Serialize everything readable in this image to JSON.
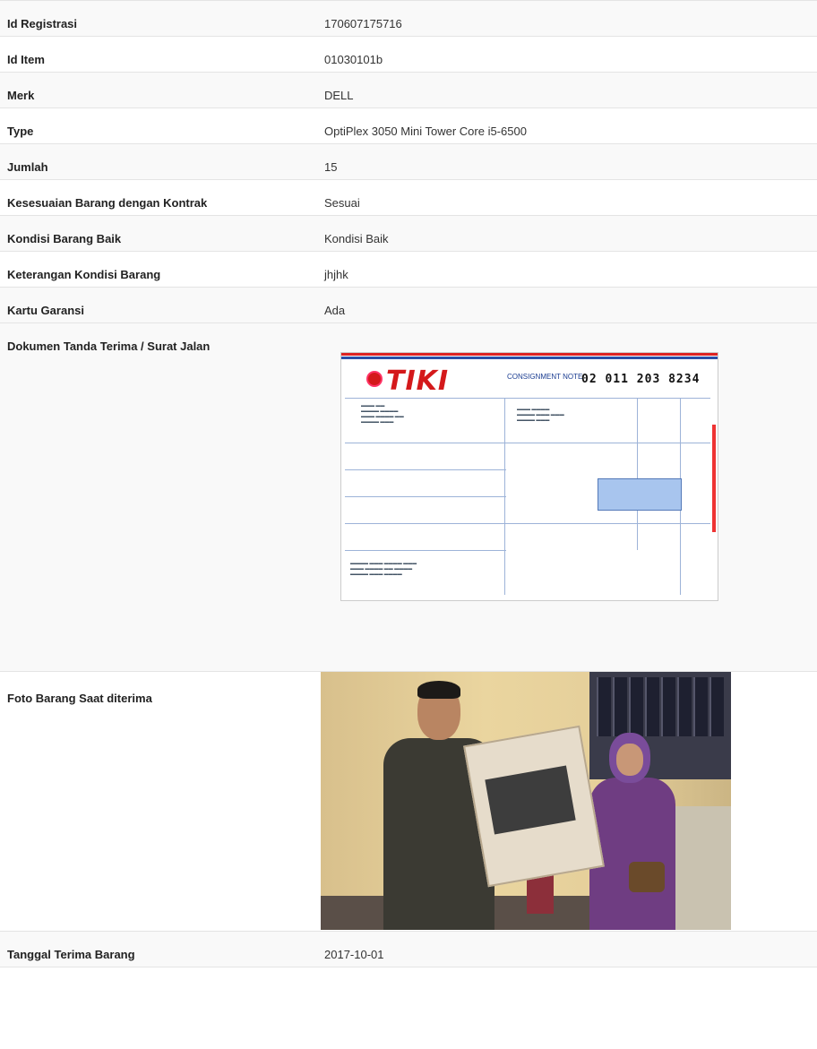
{
  "rows": [
    {
      "label": "Id Registrasi",
      "value": "170607175716"
    },
    {
      "label": "Id Item",
      "value": "01030101b"
    },
    {
      "label": "Merk",
      "value": "DELL"
    },
    {
      "label": "Type",
      "value": "OptiPlex 3050 Mini Tower Core i5-6500"
    },
    {
      "label": "Jumlah",
      "value": "15"
    },
    {
      "label": "Kesesuaian Barang dengan Kontrak",
      "value": "Sesuai"
    },
    {
      "label": "Kondisi Barang Baik",
      "value": "Kondisi Baik"
    },
    {
      "label": "Keterangan Kondisi Barang",
      "value": "jhjhk"
    },
    {
      "label": "Kartu Garansi",
      "value": "Ada"
    }
  ],
  "document_row": {
    "label": "Dokumen Tanda Terima / Surat Jalan",
    "image": {
      "logo_text": "TIKI",
      "consignment_label": "CONSIGNMENT NOTE",
      "consignment_number": "02 011 203 8234"
    }
  },
  "photo_row": {
    "label": "Foto Barang Saat diterima"
  },
  "date_row": {
    "label": "Tanggal Terima Barang",
    "value": "2017-10-01"
  },
  "colors": {
    "stripe": "#f9f9f9",
    "border": "#e4e4e4",
    "tiki_red": "#d4191b"
  }
}
